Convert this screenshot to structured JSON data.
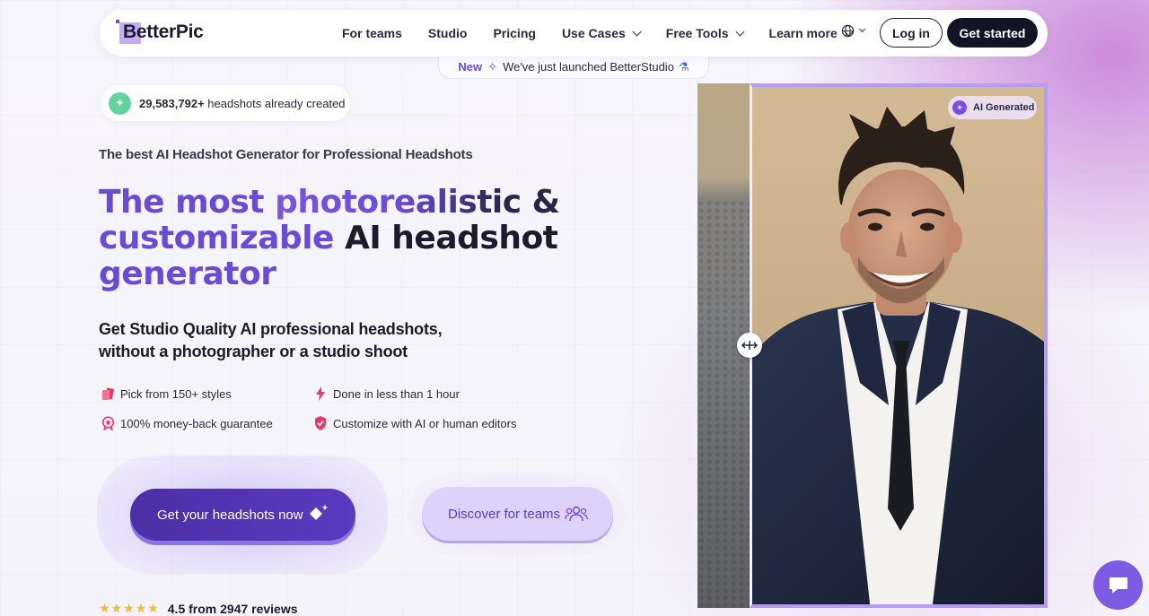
{
  "brand": {
    "name": "BetterPic"
  },
  "nav": {
    "items": [
      {
        "label": "For teams",
        "dropdown": false
      },
      {
        "label": "Studio",
        "dropdown": false
      },
      {
        "label": "Pricing",
        "dropdown": false
      },
      {
        "label": "Use Cases",
        "dropdown": true
      },
      {
        "label": "Free Tools",
        "dropdown": true
      },
      {
        "label": "Learn more",
        "dropdown": true
      }
    ],
    "login_label": "Log in",
    "get_started_label": "Get started"
  },
  "announcement": {
    "badge": "New",
    "text": "We've just launched BetterStudio"
  },
  "counter": {
    "number": "29,583,792+",
    "text": "headshots already created"
  },
  "hero": {
    "subtitle": "The best AI Headshot Generator for Professional Headshots",
    "headline_line1_a": "The most ",
    "headline_line1_b": "photorealistic &",
    "headline_line2_a": "customizable ",
    "headline_line2_b": "AI headshot",
    "headline_line3": "generator",
    "lead_line1": "Get Studio Quality AI professional headshots,",
    "lead_line2": "without a photographer or a studio shoot"
  },
  "features": [
    {
      "icon": "styles-icon",
      "text": "Pick from 150+ styles"
    },
    {
      "icon": "lightning-icon",
      "text": "Done in less than 1 hour"
    },
    {
      "icon": "money-back-icon",
      "text": "100% money-back guarantee"
    },
    {
      "icon": "shield-check-icon",
      "text": "Customize with AI or human editors"
    }
  ],
  "cta": {
    "primary_label": "Get your headshots now",
    "secondary_label": "Discover for teams"
  },
  "reviews": {
    "rating": 4.5,
    "text": "4.5 from 2947 reviews"
  },
  "photo": {
    "tag": "AI Generated"
  },
  "colors": {
    "accent": "#6a4bd6",
    "dark": "#121426",
    "cta": "#4b2fa6",
    "secondary": "#dcd2fb"
  }
}
